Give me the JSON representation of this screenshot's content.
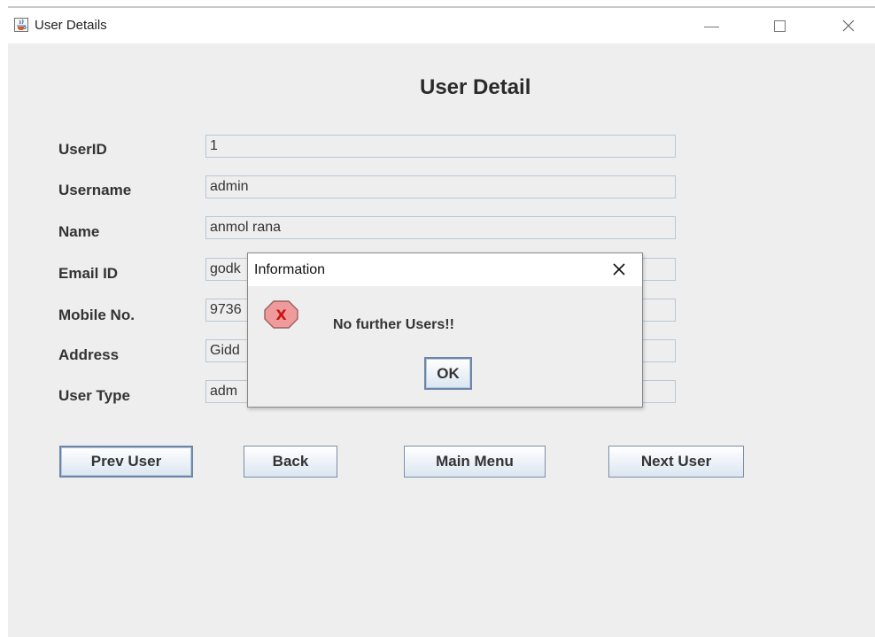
{
  "window": {
    "title": "User Details",
    "controls": {
      "minimize": "minimize-icon",
      "maximize": "maximize-icon",
      "close": "close-icon"
    }
  },
  "form": {
    "title": "User Detail",
    "fields": [
      {
        "label": "UserID",
        "value": "1"
      },
      {
        "label": "Username",
        "value": "admin"
      },
      {
        "label": "Name",
        "value": "anmol rana"
      },
      {
        "label": "Email ID",
        "value": "godk"
      },
      {
        "label": "Mobile No.",
        "value": "9736"
      },
      {
        "label": "Address",
        "value": "Gidd"
      },
      {
        "label": "User Type",
        "value": "adm"
      }
    ]
  },
  "buttons": {
    "prev_user": "Prev User",
    "back": "Back",
    "main_menu": "Main Menu",
    "next_user": "Next User"
  },
  "dialog": {
    "title": "Information",
    "message": "No further Users!!",
    "ok_label": "OK",
    "icon": "error-icon",
    "icon_letter": "X"
  },
  "colors": {
    "background": "#eeeeee",
    "input_border": "#b7c7d9",
    "button_border": "#7d8ea4",
    "error_red": "#d93a3a"
  }
}
